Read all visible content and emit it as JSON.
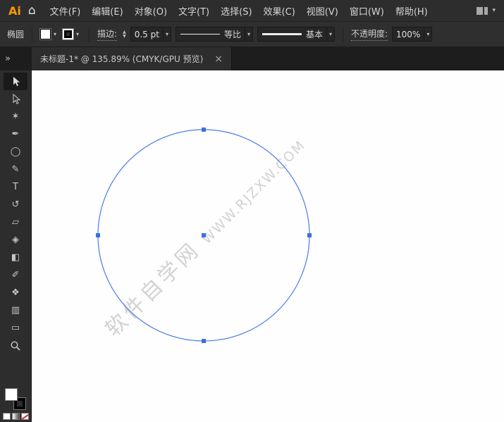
{
  "icons": {
    "dropdown": "▾",
    "stepper_up": "▲",
    "stepper_down": "▼",
    "close": "×",
    "expand": "»",
    "home": "⌂"
  },
  "menubar": {
    "logo": "Ai",
    "items": [
      "文件(F)",
      "编辑(E)",
      "对象(O)",
      "文字(T)",
      "选择(S)",
      "效果(C)",
      "视图(V)",
      "窗口(W)",
      "帮助(H)"
    ]
  },
  "controlbar": {
    "tool_name": "椭圆",
    "stroke_label": "描边:",
    "stroke_weight": "0.5 pt",
    "width_profile": "等比",
    "brush": "基本",
    "opacity_label": "不透明度:",
    "opacity_value": "100%"
  },
  "tab": {
    "title": "未标题-1* @ 135.89% (CMYK/GPU 预览)"
  },
  "toolbar": {
    "glyphs": {
      "magic_wand": "✶",
      "pen": "✒",
      "ellipse": "◯",
      "paintbrush": "✎",
      "type": "T",
      "rotate": "↺",
      "eraser": "▱",
      "shape_builder": "◈",
      "gradient": "◧",
      "eyedropper": "✐",
      "blend": "❖",
      "graph": "▥",
      "artboard": "▭"
    }
  },
  "swatches": {
    "fill_color": "#ffffff",
    "stroke_color": "#000000"
  },
  "canvas": {
    "watermark_cn": "软件自学网",
    "watermark_en": "WWW.RJZXW.COM",
    "selection_color": "#4a7ce8",
    "anchor_color": "#3a6fe0"
  }
}
